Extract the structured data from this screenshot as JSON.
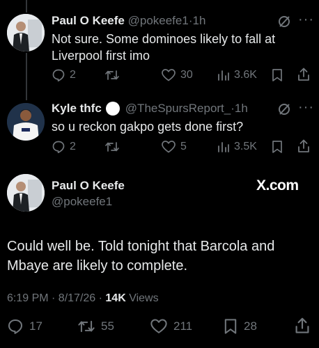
{
  "tweets": [
    {
      "name": "Paul O Keefe",
      "handle": "@pokeefe1",
      "sep": "·",
      "time": "1h",
      "text_line1": "Not sure. Some dominoes likely to fall at",
      "text_line2": "Liverpool first imo",
      "replies": "2",
      "likes": "30",
      "views": "3.6K"
    },
    {
      "name": "Kyle thfc",
      "handle": "@TheSpursReport_",
      "sep": "·",
      "time": "1h",
      "text_line1": "so u reckon gakpo gets done first?",
      "replies": "2",
      "likes": "5",
      "views": "3.5K"
    }
  ],
  "main": {
    "name": "Paul O Keefe",
    "handle": "@pokeefe1",
    "brand": "X.com",
    "text_line1": "Could well be. Told tonight that Barcola and",
    "text_line2": "Mbaye are likely to complete.",
    "timestamp": "6:19 PM · 8/17/26 · ",
    "views_count": "14K",
    "views_label": " Views",
    "stats": {
      "replies": "17",
      "reposts": "55",
      "likes": "211",
      "bookmarks": "28"
    }
  },
  "icons": {
    "more": "more-icon",
    "grok": "grok-icon",
    "reply": "reply-icon",
    "repost": "repost-icon",
    "like": "like-icon",
    "views": "views-icon",
    "bookmark": "bookmark-icon",
    "share": "share-icon"
  },
  "colors": {
    "background": "#000000",
    "text": "#e7e9ea",
    "muted": "#71767b"
  }
}
